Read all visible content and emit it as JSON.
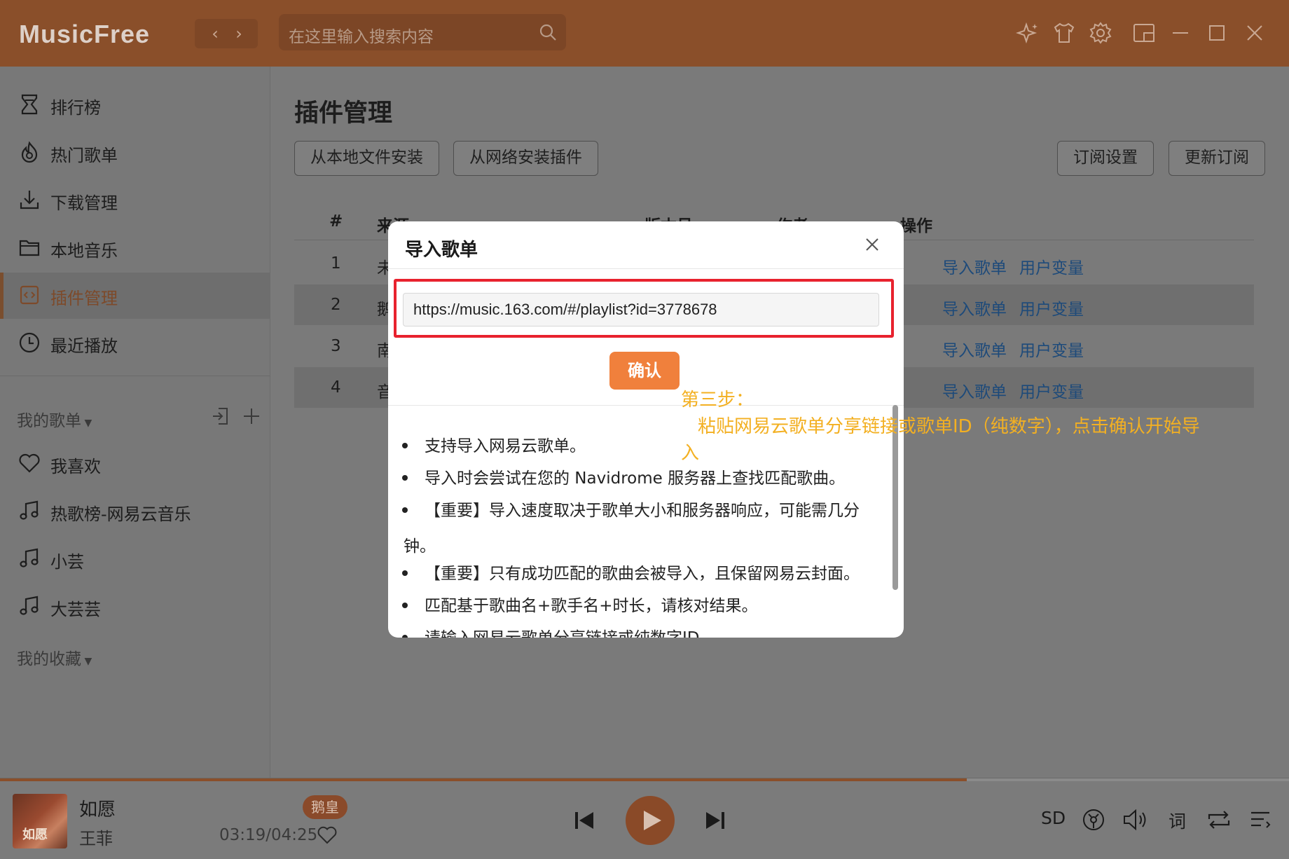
{
  "app": {
    "name": "MusicFree",
    "search_placeholder": "在这里输入搜索内容"
  },
  "sidebar": {
    "items": [
      {
        "label": "排行榜",
        "icon": "trophy-icon"
      },
      {
        "label": "热门歌单",
        "icon": "fire-icon"
      },
      {
        "label": "下载管理",
        "icon": "download-icon"
      },
      {
        "label": "本地音乐",
        "icon": "folder-icon"
      },
      {
        "label": "插件管理",
        "icon": "plugin-icon",
        "active": true
      },
      {
        "label": "最近播放",
        "icon": "clock-icon"
      }
    ],
    "my_playlists_title": "我的歌单",
    "playlists": [
      {
        "label": "我喜欢",
        "icon": "heart-icon"
      },
      {
        "label": "热歌榜-网易云音乐",
        "icon": "music-note-icon"
      },
      {
        "label": "小芸",
        "icon": "music-note-icon"
      },
      {
        "label": "大芸芸",
        "icon": "music-note-icon"
      }
    ],
    "my_favorites_title": "我的收藏"
  },
  "main": {
    "title": "插件管理",
    "install_local": "从本地文件安装",
    "install_network": "从网络安装插件",
    "subscribe_settings": "订阅设置",
    "update_subscription": "更新订阅",
    "columns": [
      "#",
      "来源",
      "版本号",
      "作者",
      "操作"
    ],
    "rows": [
      {
        "num": "1",
        "source": "未",
        "action1": "导入歌单",
        "action2": "用户变量"
      },
      {
        "num": "2",
        "source": "鹅",
        "action1": "导入歌单",
        "action2": "用户变量"
      },
      {
        "num": "3",
        "source": "南",
        "action1": "导入歌单",
        "action2": "用户变量"
      },
      {
        "num": "4",
        "source": "音",
        "action1": "导入歌单",
        "action2": "用户变量"
      }
    ]
  },
  "modal": {
    "title": "导入歌单",
    "url_value": "https://music.163.com/#/playlist?id=3778678",
    "confirm": "确认",
    "notes": [
      "支持导入网易云歌单。",
      "导入时会尝试在您的 Navidrome 服务器上查找匹配歌曲。",
      "【重要】导入速度取决于歌单大小和服务器响应，可能需几分",
      "钟。",
      "【重要】只有成功匹配的歌曲会被导入，且保留网易云封面。",
      "匹配基于歌曲名+歌手名+时长，请核对结果。",
      "请输入网易云歌单分享链接或纯数字ID。"
    ]
  },
  "annotation": {
    "line1": "第三步：",
    "line2": "粘贴网易云歌单分享链接或歌单ID（纯数字），点击确认开始导",
    "line3": "入"
  },
  "player": {
    "song": "如愿",
    "artist": "王菲",
    "cover_text": "如愿",
    "plugin": "鹅皇",
    "time": "03:19/04:25",
    "progress": 0.75,
    "quality": "SD",
    "lyrics": "词"
  },
  "colors": {
    "accent": "#f0803c",
    "titlebar": "#8a4f2a",
    "highlight": "#e8222e",
    "annotation": "#f3b022"
  }
}
